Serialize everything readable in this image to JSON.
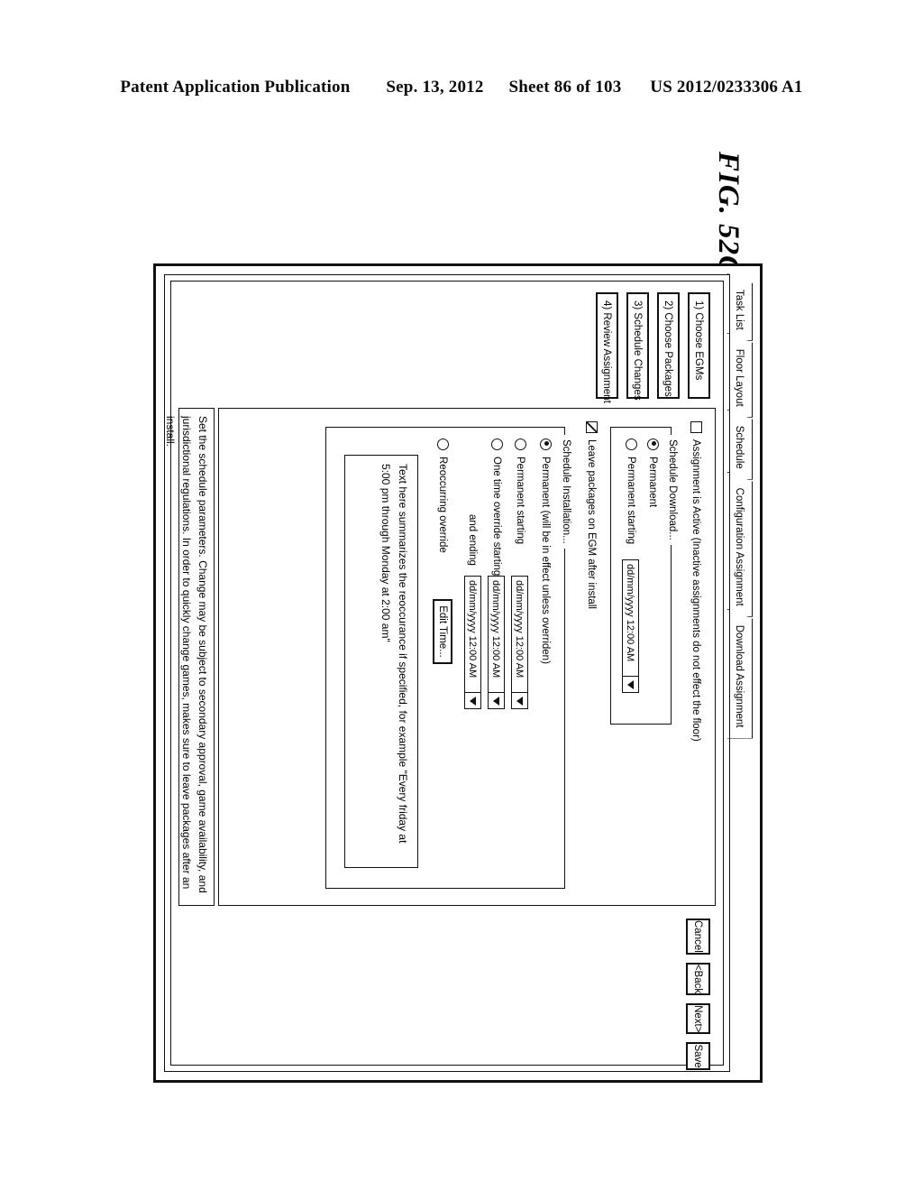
{
  "patent_header": {
    "publication": "Patent Application Publication",
    "date": "Sep. 13, 2012",
    "sheet": "Sheet 86 of 103",
    "number": "US 2012/0233306 A1"
  },
  "figure_label": "FIG. 52C",
  "tabs": [
    {
      "label": "Task List"
    },
    {
      "label": "Floor Layout"
    },
    {
      "label": "Schedule"
    },
    {
      "label": "Configuration Assignment"
    },
    {
      "label": "Download Assignment"
    }
  ],
  "wizard_steps": [
    {
      "label": "1) Choose EGMs"
    },
    {
      "label": "2) Choose Packages"
    },
    {
      "label": "3) Schedule Changes"
    },
    {
      "label": "4) Review Assignment"
    }
  ],
  "form": {
    "active_checkbox": {
      "label": "Assignment is Active (Inactive assignments do not effect the floor)",
      "checked": false
    },
    "schedule_download": {
      "title": "Schedule Download...",
      "options": [
        {
          "label": "Permanent",
          "selected": true
        },
        {
          "label": "Permanent starting",
          "selected": false
        }
      ],
      "start_value": "dd/mm/yyyy 12:00 AM"
    },
    "leave_packages_checkbox": {
      "label": "Leave packages on EGM after install",
      "checked": true
    },
    "schedule_installation": {
      "title": "Schedule Installation...",
      "options": [
        {
          "label": "Permanent (will be in effect unless overriden)",
          "selected": true
        },
        {
          "label": "Permanent starting",
          "selected": false
        },
        {
          "label": "One time override starting",
          "selected": false
        },
        {
          "label": "Reoccurring override",
          "selected": false
        }
      ],
      "and_ending_label": "and ending",
      "permanent_starting_value": "dd/mm/yyyy 12:00 AM",
      "override_starting_value": "dd/mm/yyyy 12:00 AM",
      "override_ending_value": "dd/mm/yyyy 12:00 AM",
      "edit_time_label": "Edit Time...",
      "summary_text": "Text here summarizes the reoccurance if specified, for example \"Every friday at 5:00 pm through Monday at 2:00 am\""
    }
  },
  "help_text": "Set the schedule parameters. Change may be subject to secondary approval, game availability,  and jurisdictional regulations. In order to quickly change games, makes sure to leave packages after an install.",
  "actions": [
    {
      "label": "Cancel"
    },
    {
      "label": "<Back"
    },
    {
      "label": "Next>"
    },
    {
      "label": "Save"
    }
  ]
}
